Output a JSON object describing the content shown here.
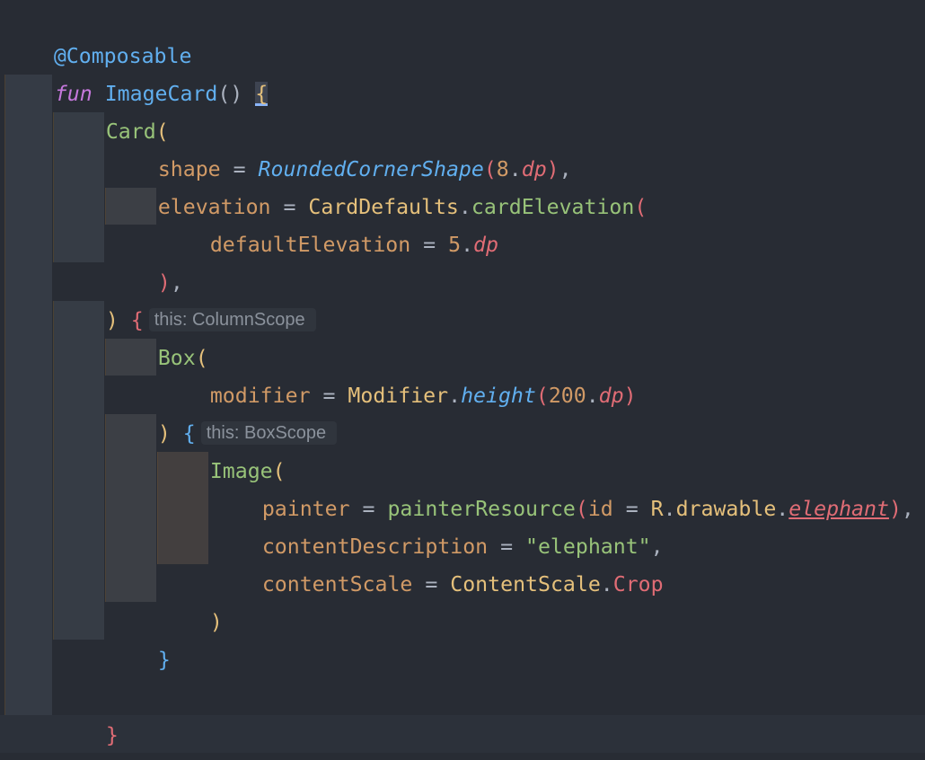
{
  "editor": {
    "language": "Kotlin",
    "colors": {
      "background": "#282c34",
      "keyword": "#c678dd",
      "function": "#61afef",
      "class": "#98c379",
      "parameter": "#d19a66",
      "unit": "#e06c75",
      "string": "#98c379"
    },
    "lines": {
      "l1": {
        "annotation": "@Composable"
      },
      "l2": {
        "kw": "fun",
        "name": "ImageCard",
        "parens": "()",
        "brace": "{"
      },
      "l3": {
        "name": "Card",
        "open": "("
      },
      "l4": {
        "param": "shape",
        "eq": " = ",
        "fn": "RoundedCornerShape",
        "open": "(",
        "num": "8",
        "dot": ".",
        "unit": "dp",
        "close": ")",
        "comma": ","
      },
      "l5": {
        "param": "elevation",
        "eq": " = ",
        "obj": "CardDefaults",
        "dot": ".",
        "call": "cardElevation",
        "open": "("
      },
      "l6": {
        "param": "defaultElevation",
        "eq": " = ",
        "num": "5",
        "dot": ".",
        "unit": "dp"
      },
      "l7": {
        "close": ")",
        "comma": ","
      },
      "l8": {
        "close": ")",
        "brace": "{",
        "hint": "this: ColumnScope"
      },
      "l9": {
        "name": "Box",
        "open": "("
      },
      "l10": {
        "param": "modifier",
        "eq": " = ",
        "obj": "Modifier",
        "dot": ".",
        "call": "height",
        "open": "(",
        "num": "200",
        "dot2": ".",
        "unit": "dp",
        "close": ")"
      },
      "l11": {
        "close": ")",
        "brace": "{",
        "hint": "this: BoxScope"
      },
      "l12": {
        "name": "Image",
        "open": "("
      },
      "l13": {
        "param": "painter",
        "eq": " = ",
        "call": "painterResource",
        "open": "(",
        "arg": "id",
        "eq2": " = ",
        "obj": "R",
        "dot": ".",
        "mid": "drawable",
        "dot2": ".",
        "prop": "elephant",
        "close": ")",
        "comma": ","
      },
      "l14": {
        "param": "contentDescription",
        "eq": " = ",
        "str": "\"elephant\"",
        "comma": ","
      },
      "l15": {
        "param": "contentScale",
        "eq": " = ",
        "obj": "ContentScale",
        "dot": ".",
        "enum": "Crop"
      },
      "l16": {
        "close": ")"
      },
      "l17": {
        "brace": "}"
      },
      "l19": {
        "brace": "}"
      },
      "l20": {
        "brace": "}"
      }
    }
  }
}
